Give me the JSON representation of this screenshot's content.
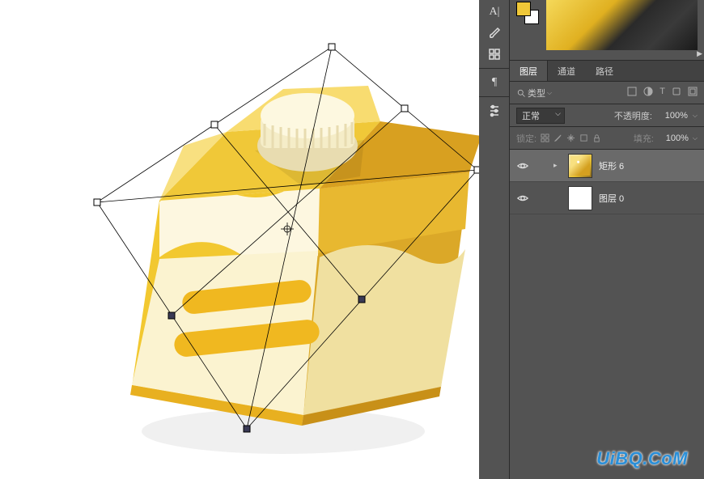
{
  "panels": {
    "tabs": {
      "layers": "图层",
      "channels": "通道",
      "paths": "路径"
    },
    "filter": {
      "kind_label": "类型"
    },
    "blend": {
      "mode": "正常",
      "opacity_label": "不透明度:",
      "opacity_value": "100%"
    },
    "lock": {
      "label": "锁定:",
      "fill_label": "填充:",
      "fill_value": "100%"
    }
  },
  "layers": [
    {
      "name": "矩形 6",
      "visible": true,
      "selected": true,
      "expandable": true
    },
    {
      "name": "图层 0",
      "visible": true,
      "selected": false,
      "expandable": false
    }
  ],
  "watermark": "UiBQ.CoM"
}
